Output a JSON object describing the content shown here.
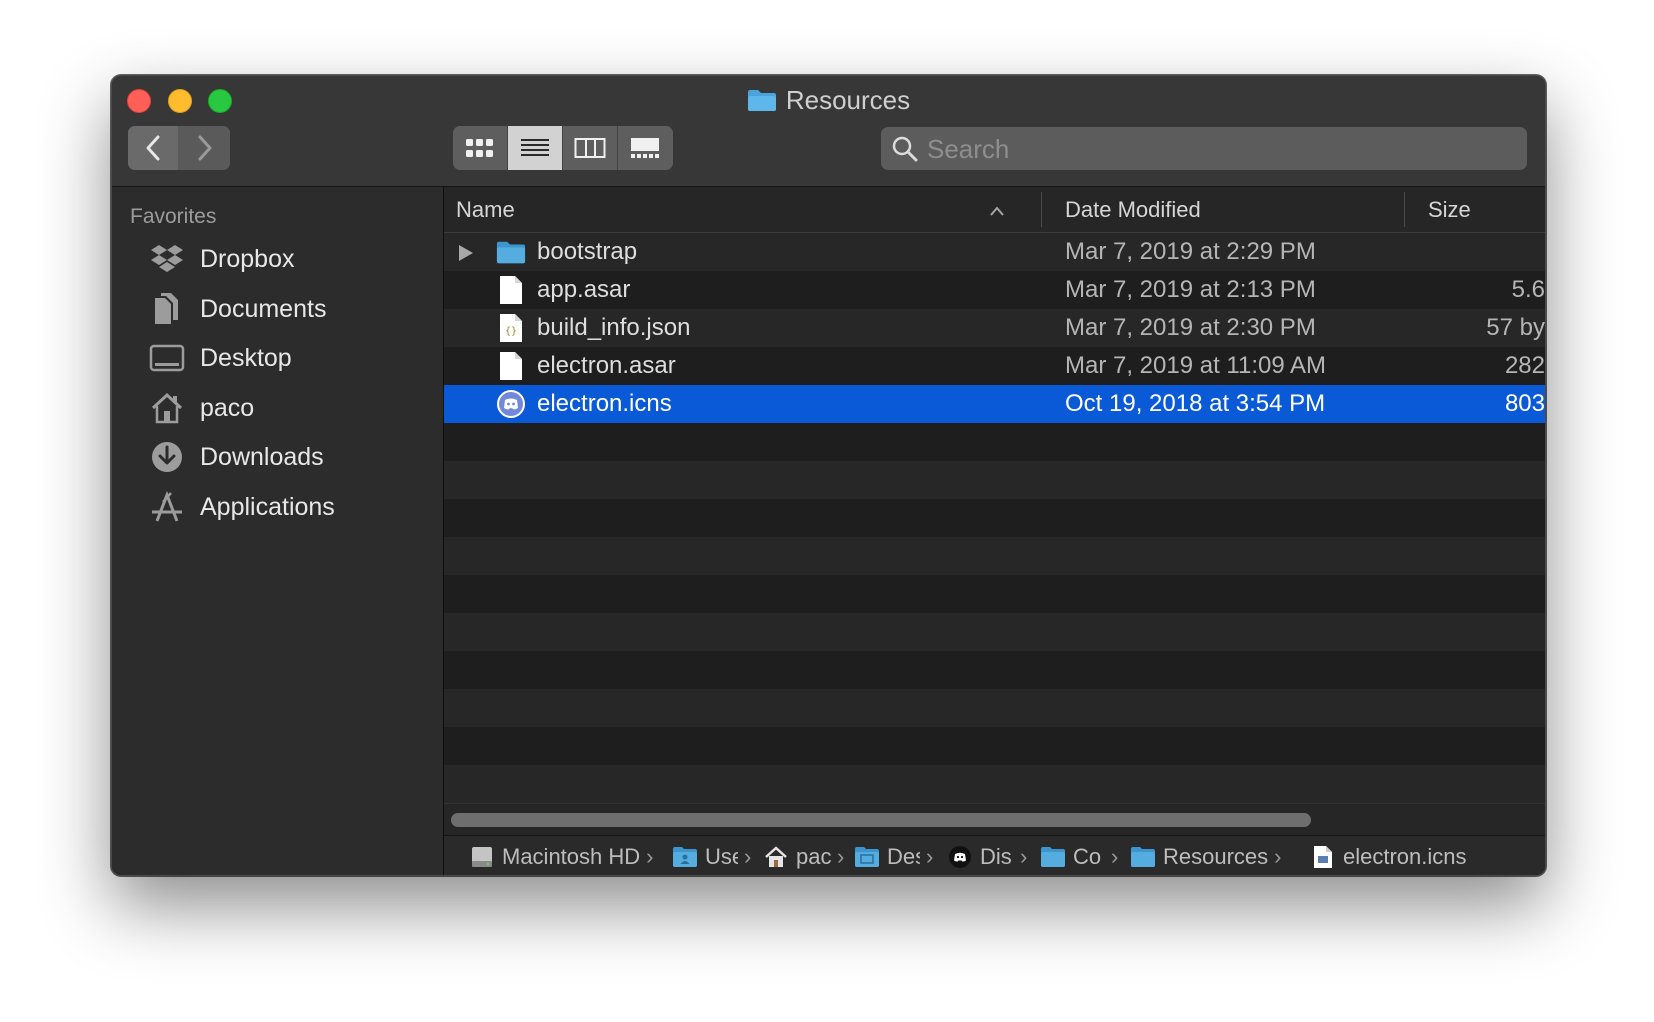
{
  "window": {
    "title": "Resources"
  },
  "toolbar": {
    "back_label": "Back",
    "forward_label": "Forward",
    "views": [
      "icon-view",
      "list-view",
      "column-view",
      "gallery-view"
    ],
    "active_view": "list-view",
    "search_placeholder": "Search"
  },
  "sidebar": {
    "heading": "Favorites",
    "items": [
      {
        "label": "Dropbox",
        "icon": "dropbox-icon"
      },
      {
        "label": "Documents",
        "icon": "documents-icon"
      },
      {
        "label": "Desktop",
        "icon": "desktop-icon"
      },
      {
        "label": "paco",
        "icon": "home-icon"
      },
      {
        "label": "Downloads",
        "icon": "downloads-icon"
      },
      {
        "label": "Applications",
        "icon": "applications-icon"
      }
    ]
  },
  "columns": {
    "name": "Name",
    "date": "Date Modified",
    "size": "Size"
  },
  "files": [
    {
      "name": "bootstrap",
      "date": "Mar 7, 2019 at 2:29 PM",
      "size": "",
      "icon": "folder-icon",
      "expandable": true,
      "selected": false
    },
    {
      "name": "app.asar",
      "date": "Mar 7, 2019 at 2:13 PM",
      "size": "5.6 ",
      "icon": "document-icon",
      "expandable": false,
      "selected": false
    },
    {
      "name": "build_info.json",
      "date": "Mar 7, 2019 at 2:30 PM",
      "size": "57 by",
      "icon": "json-file-icon",
      "expandable": false,
      "selected": false
    },
    {
      "name": "electron.asar",
      "date": "Mar 7, 2019 at 11:09 AM",
      "size": "282",
      "icon": "document-icon",
      "expandable": false,
      "selected": false
    },
    {
      "name": "electron.icns",
      "date": "Oct 19, 2018 at 3:54 PM",
      "size": "803",
      "icon": "discord-icon",
      "expandable": false,
      "selected": true
    }
  ],
  "pathbar": [
    {
      "label": "Macintosh HD",
      "icon": "hard-drive-icon"
    },
    {
      "label": "Use",
      "icon": "users-folder-icon"
    },
    {
      "label": "pac",
      "icon": "home-icon"
    },
    {
      "label": "Des",
      "icon": "desktop-folder-icon"
    },
    {
      "label": "Dis",
      "icon": "discord-icon"
    },
    {
      "label": "Co",
      "icon": "folder-icon"
    },
    {
      "label": "Resources",
      "icon": "folder-icon"
    },
    {
      "label": "electron.icns",
      "icon": "icns-file-icon"
    }
  ],
  "colors": {
    "selection": "#0a5ad8",
    "folder": "#4aa3dc",
    "close": "#fe5f57",
    "minimize": "#febc2e",
    "maximize": "#28c840"
  }
}
